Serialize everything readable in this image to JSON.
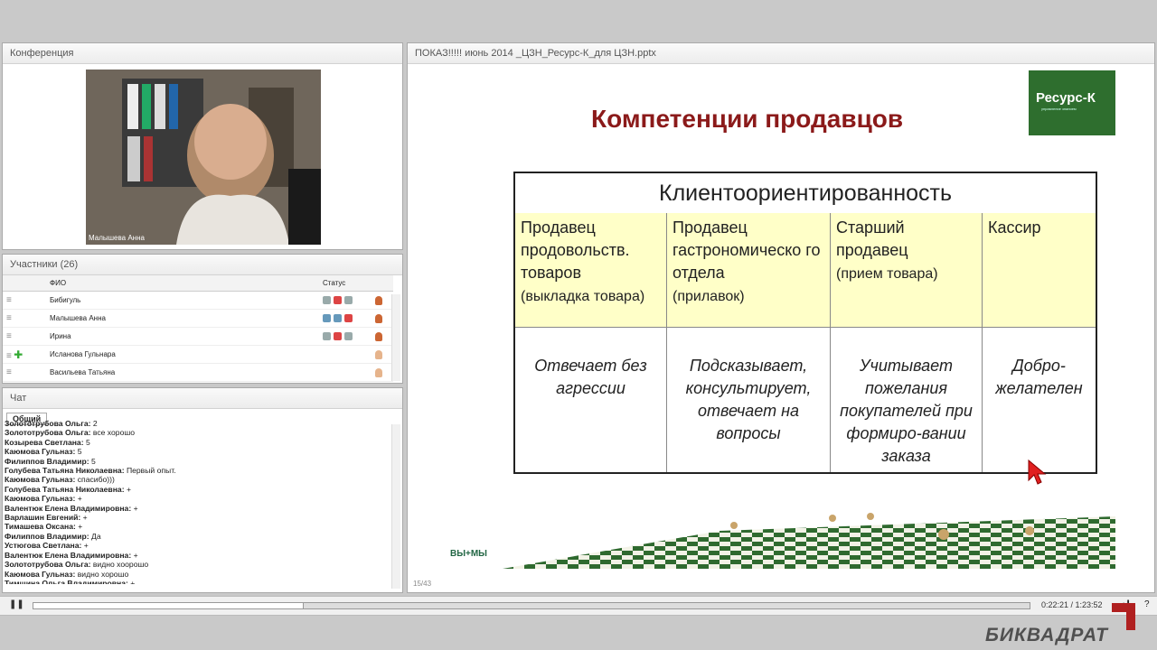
{
  "conference": {
    "title": "Конференция",
    "video_caption": "Малышева Анна"
  },
  "participants": {
    "title": "Участники (26)",
    "col_name": "ФИО",
    "col_status": "Статус",
    "rows": [
      {
        "name": "Бибигуль"
      },
      {
        "name": "Малышева Анна"
      },
      {
        "name": "Ирина"
      },
      {
        "name": "Исланова Гульнара"
      },
      {
        "name": "Васильева Татьяна"
      }
    ]
  },
  "chat": {
    "title": "Чат",
    "tab": "Общий",
    "messages": [
      {
        "author": "Золототрубова  Ольга:",
        "text": " 2"
      },
      {
        "author": "Золототрубова  Ольга:",
        "text": " все хорошо"
      },
      {
        "author": "Козырева Светлана:",
        "text": " 5"
      },
      {
        "author": "Каюмова  Гульназ:",
        "text": " 5"
      },
      {
        "author": "Филиппов Владимир:",
        "text": " 5"
      },
      {
        "author": "Голубева Татьяна Николаевна:",
        "text": " Первый опыт."
      },
      {
        "author": "Каюмова  Гульназ:",
        "text": " спасибо)))"
      },
      {
        "author": "Голубева Татьяна Николаевна:",
        "text": " +"
      },
      {
        "author": "Каюмова  Гульназ:",
        "text": " +"
      },
      {
        "author": "Валентюк Елена Владимировна:",
        "text": " +"
      },
      {
        "author": "Варлашин Евгений:",
        "text": " +"
      },
      {
        "author": "Тимашева Оксана:",
        "text": " +"
      },
      {
        "author": "Филиппов Владимир:",
        "text": " Да"
      },
      {
        "author": "Устюгова Светлана:",
        "text": " +"
      },
      {
        "author": "Валентюк Елена Владимировна:",
        "text": " +"
      },
      {
        "author": "Золототрубова  Ольга:",
        "text": " видно хоорошо"
      },
      {
        "author": "Каюмова  Гульназ:",
        "text": " видно хорошо"
      },
      {
        "author": "Тимшина   Ольга  Владимировна:",
        "text": " +"
      }
    ]
  },
  "presentation": {
    "title": "ПОКАЗ!!!!!  июнь 2014 _ЦЗН_Ресурс-К_для ЦЗН.pptx",
    "slide_counter": "15/43"
  },
  "slide": {
    "title": "Компетенции продавцов",
    "logo_text": "Ресурс-К",
    "logo_sub": "управление знанием",
    "footer_logo": "ВЫ+МЫ",
    "table_header": "Клиентоориентированность",
    "columns": [
      {
        "role": "Продавец продовольств. товаров",
        "note": "(выкладка товара)",
        "behavior": "Отвечает без агрессии"
      },
      {
        "role": "Продавец гастрономическо го отдела",
        "note": "(прилавок)",
        "behavior": "Подсказывает, консультирует, отвечает на вопросы"
      },
      {
        "role": "Старший продавец",
        "note": "(прием товара)",
        "behavior": "Учитывает пожелания покупателей при формиро-вании заказа"
      },
      {
        "role": "Кассир",
        "note": "",
        "behavior": "Добро-желателен"
      }
    ]
  },
  "player": {
    "progress_fraction": 0.27,
    "time": "0:22:21 / 1:23:52"
  },
  "brand": "БИКВАДРАТ",
  "colors": {
    "slide_title": "#8b1a1a",
    "cell_fill": "#ffffc8",
    "logo_bg": "#2e6e2e"
  }
}
